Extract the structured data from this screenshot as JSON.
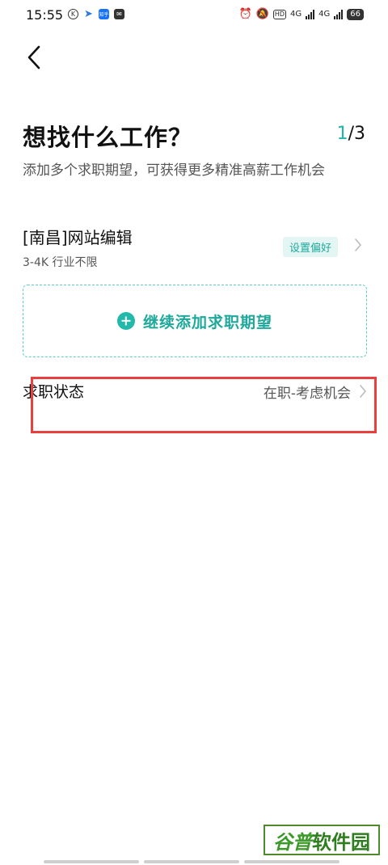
{
  "status_bar": {
    "time": "15:55",
    "icons_left": [
      "k-circle-icon",
      "telegram-plane-icon",
      "zhihu-app-icon",
      "mail-icon"
    ],
    "zhihu_text": "知乎",
    "hd_label": "HD",
    "net_1": "4G",
    "net_2": "4G",
    "battery": "66"
  },
  "header": {
    "title": "想找什么工作？",
    "step_current": "1",
    "step_total": "/3",
    "subtitle": "添加多个求职期望，可获得更多精准高薪工作机会"
  },
  "job_expectation": {
    "title": "[南昌]网站编辑",
    "meta": "3-4K 行业不限",
    "pref_label": "设置偏好"
  },
  "add_more": {
    "label": "继续添加求职期望"
  },
  "job_status": {
    "label": "求职状态",
    "value": "在职-考虑机会"
  },
  "watermark": {
    "part_a": "谷普",
    "part_b": "软件园"
  },
  "colors": {
    "accent": "#1fb5a8",
    "highlight": "#e8403f"
  }
}
